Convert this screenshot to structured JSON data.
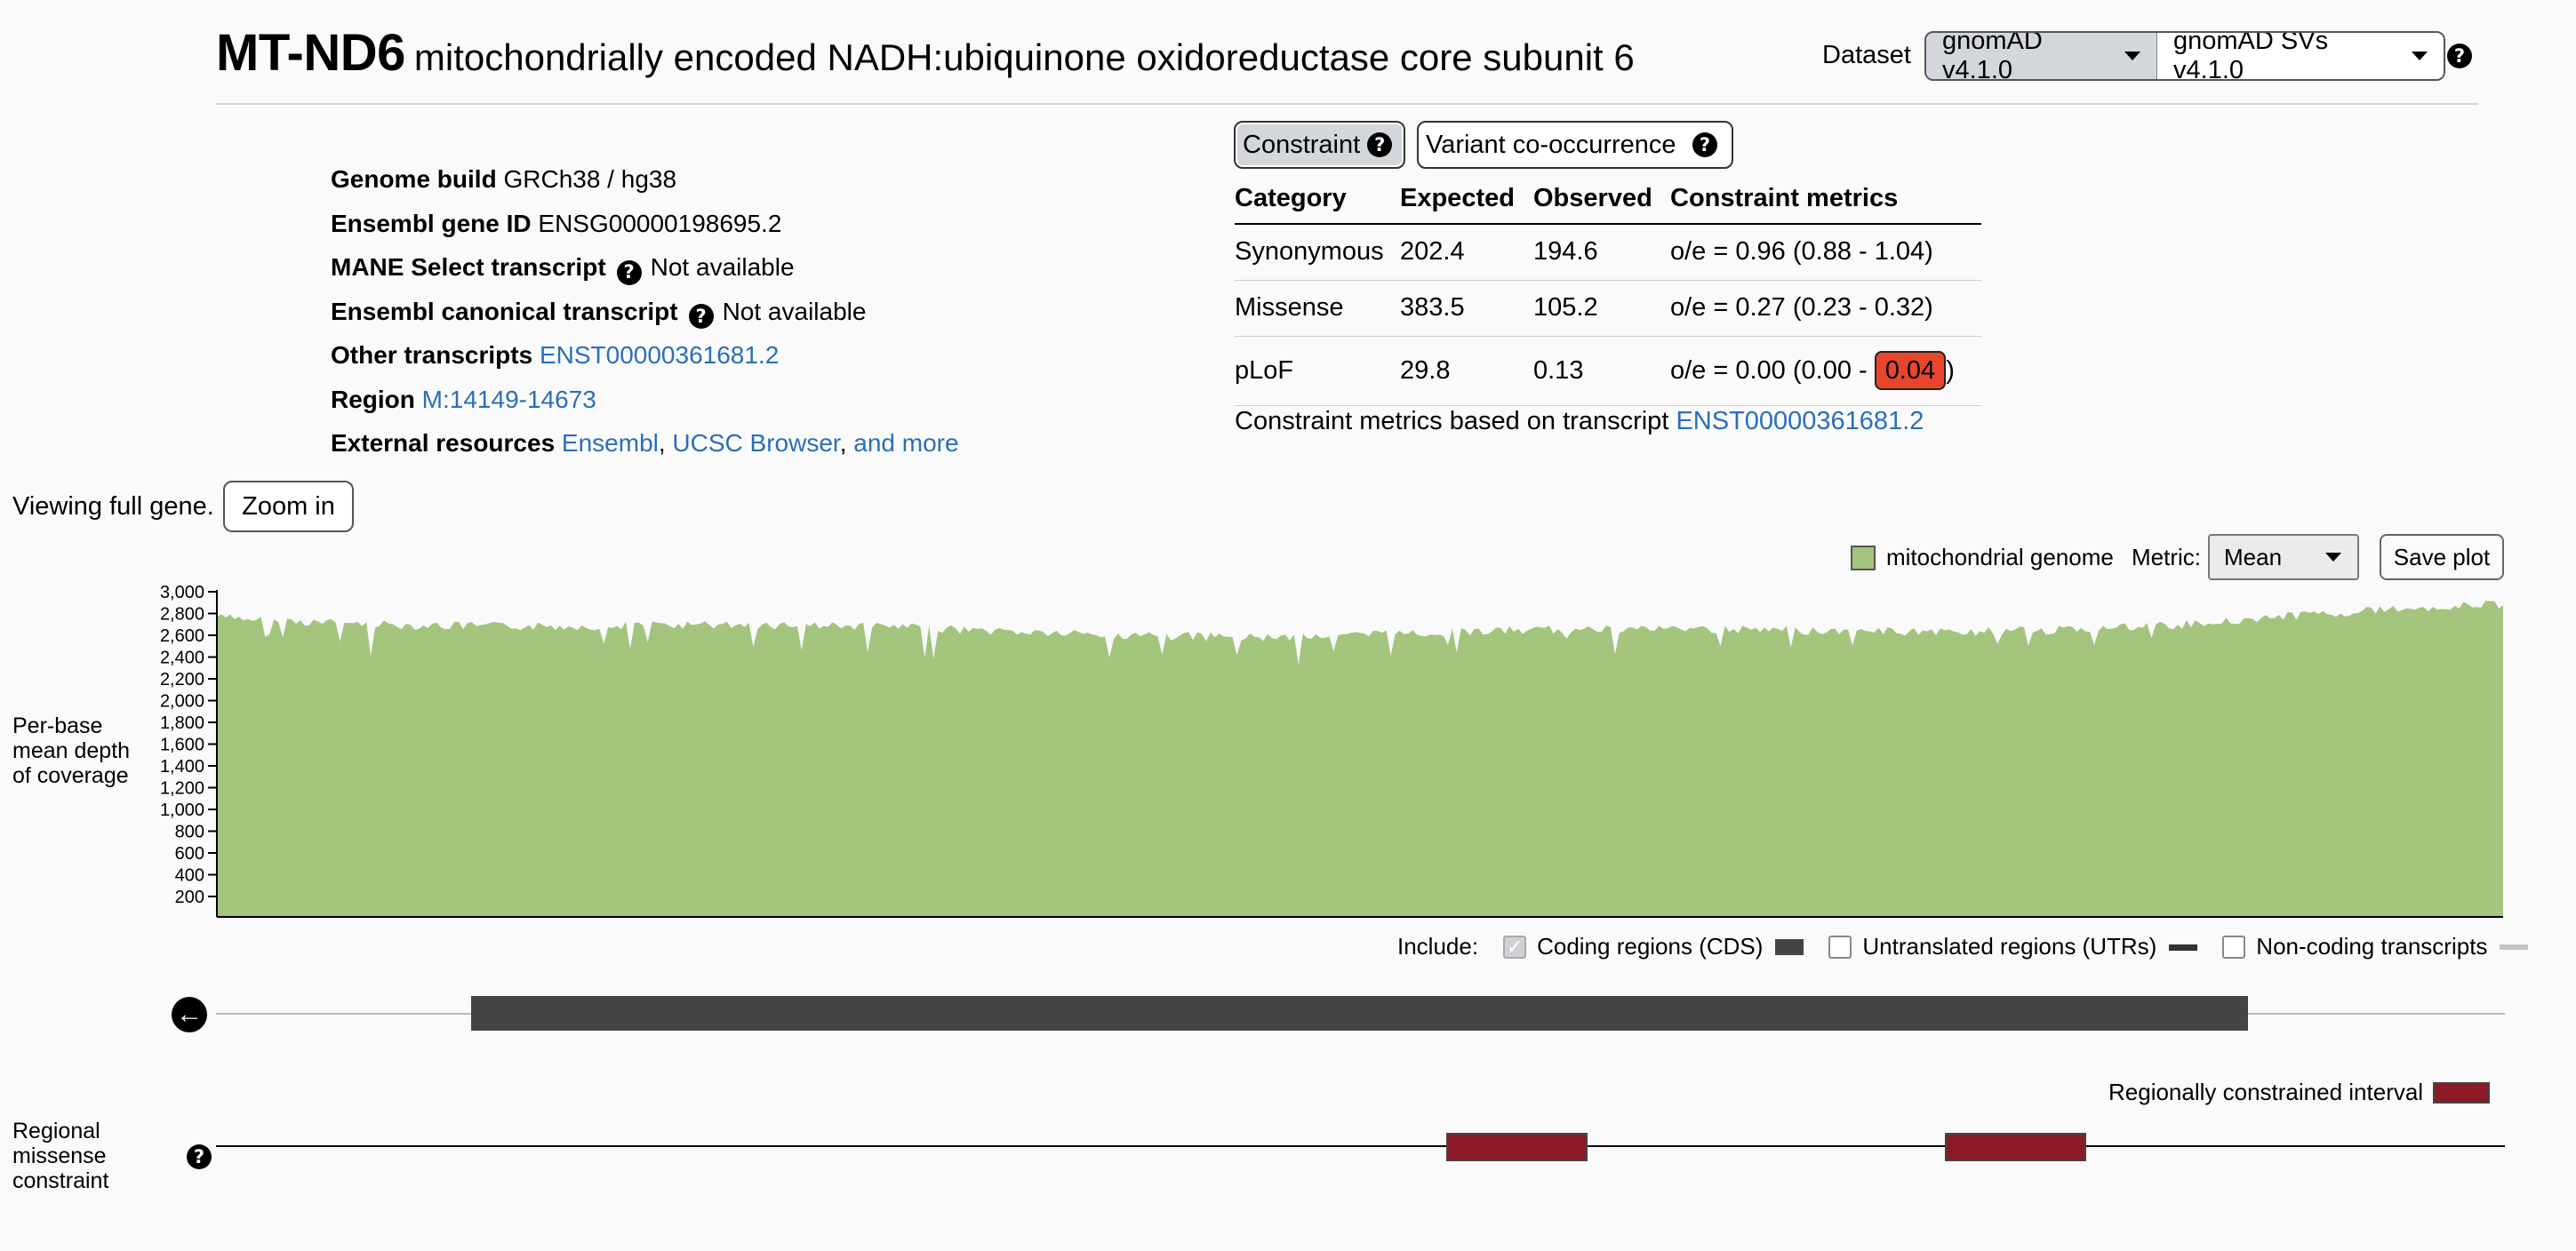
{
  "header": {
    "gene_symbol": "MT-ND6",
    "gene_name": "mitochondrially encoded NADH:ubiquinone oxidoreductase core subunit 6",
    "dataset_label": "Dataset",
    "dataset_primary": "gnomAD v4.1.0",
    "dataset_secondary": "gnomAD SVs v4.1.0",
    "help_icon": "question-circle-icon"
  },
  "attributes": {
    "genome_build_label": "Genome build",
    "genome_build_value": "GRCh38 / hg38",
    "ensembl_id_label": "Ensembl gene ID",
    "ensembl_id_value": "ENSG00000198695.2",
    "mane_label": "MANE Select transcript",
    "mane_value": "Not available",
    "canonical_label": "Ensembl canonical transcript",
    "canonical_value": "Not available",
    "other_transcripts_label": "Other transcripts",
    "other_transcripts_value": "ENST00000361681.2",
    "region_label": "Region",
    "region_value": "M:14149-14673",
    "external_label": "External resources",
    "external_links": [
      "Ensembl",
      "UCSC Browser",
      "and more"
    ],
    "sep": ","
  },
  "constraint": {
    "tabs": [
      "Constraint",
      "Variant co-occurrence"
    ],
    "columns": [
      "Category",
      "Expected",
      "Observed",
      "Constraint metrics"
    ],
    "rows": [
      {
        "category": "Synonymous",
        "expected": "202.4",
        "observed": "194.6",
        "metric": "o/e = 0.96 (0.88 - 1.04)"
      },
      {
        "category": "Missense",
        "expected": "383.5",
        "observed": "105.2",
        "metric": "o/e = 0.27 (0.23 - 0.32)"
      },
      {
        "category": "pLoF",
        "expected": "29.8",
        "observed": "0.13",
        "metric_prefix": "o/e = 0.00 (0.00 - ",
        "metric_flag": "0.04",
        "metric_suffix": ")"
      }
    ],
    "note_prefix": "Constraint metrics based on transcript",
    "note_link": "ENST00000361681.2",
    "flag_color": "#e8462c"
  },
  "zoom": {
    "viewing_text": "Viewing full gene.",
    "zoom_button": "Zoom in"
  },
  "coverage": {
    "legend_label": "mitochondrial genome",
    "metric_label": "Metric:",
    "metric_value": "Mean",
    "save_button": "Save plot",
    "yaxis_title_lines": [
      "Per-base",
      "mean depth",
      "of coverage"
    ],
    "fill_color": "#a3c47d",
    "ticks": [
      "3,000",
      "2,800",
      "2,600",
      "2,400",
      "2,200",
      "2,000",
      "1,800",
      "1,600",
      "1,400",
      "1,200",
      "1,000",
      "800",
      "600",
      "400",
      "200"
    ]
  },
  "include": {
    "label": "Include:",
    "items": [
      {
        "label": "Coding regions (CDS)",
        "checked": true
      },
      {
        "label": "Untranslated regions (UTRs)",
        "checked": false
      },
      {
        "label": "Non-coding transcripts",
        "checked": false
      }
    ]
  },
  "transcript": {
    "strand_icon": "arrow-left-circle-icon",
    "exon_color": "#444444"
  },
  "regional": {
    "legend_label": "Regionally constrained interval",
    "title_lines": [
      "Regional",
      "missense",
      "constraint"
    ],
    "interval_color": "#8b1a26"
  }
}
